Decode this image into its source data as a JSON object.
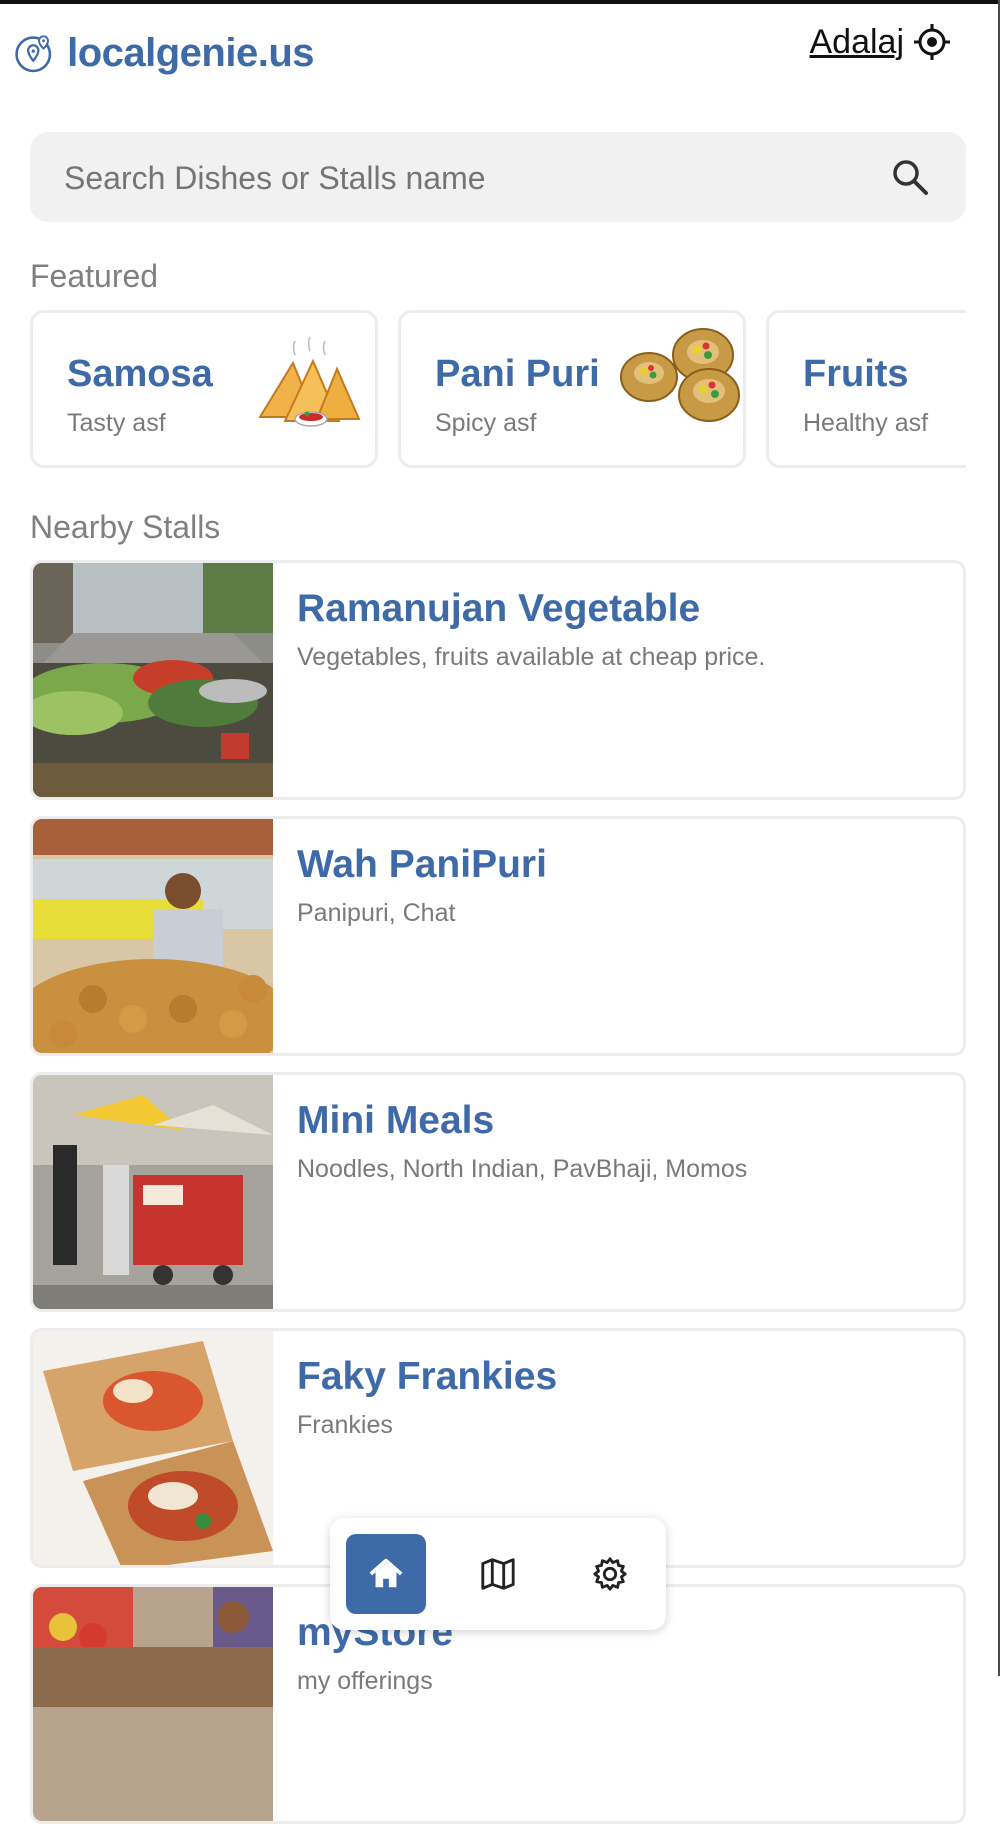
{
  "brand": {
    "name": "localgenie.us",
    "color": "#3f6aa8"
  },
  "location": {
    "label": "Adalaj"
  },
  "search": {
    "placeholder": "Search Dishes or Stalls name"
  },
  "sections": {
    "featured": "Featured",
    "nearby": "Nearby Stalls"
  },
  "featured": [
    {
      "name": "Samosa",
      "subtitle": "Tasty asf"
    },
    {
      "name": "Pani Puri",
      "subtitle": "Spicy asf"
    },
    {
      "name": "Fruits",
      "subtitle": "Healthy asf"
    }
  ],
  "stalls": [
    {
      "name": "Ramanujan Vegetable",
      "description": "Vegetables, fruits available at cheap price."
    },
    {
      "name": "Wah PaniPuri",
      "description": "Panipuri, Chat"
    },
    {
      "name": "Mini Meals",
      "description": "Noodles, North Indian, PavBhaji, Momos"
    },
    {
      "name": "Faky Frankies",
      "description": "Frankies"
    },
    {
      "name": "myStore",
      "description": "my offerings"
    }
  ],
  "nav": {
    "items": [
      "home-icon",
      "map-icon",
      "settings-icon"
    ],
    "active": "home-icon"
  }
}
